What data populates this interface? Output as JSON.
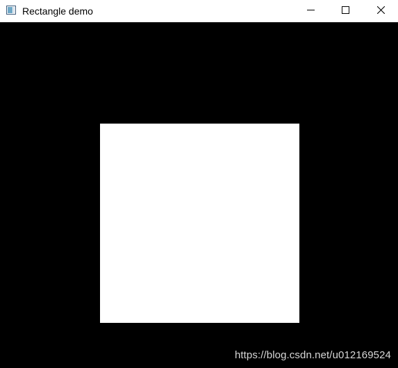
{
  "window": {
    "title": "Rectangle demo",
    "controls": {
      "minimize_icon": "minimize-icon",
      "maximize_icon": "maximize-icon",
      "close_icon": "close-icon"
    }
  },
  "canvas": {
    "background_color": "#000000",
    "shape": {
      "type": "rectangle",
      "fill_color": "#ffffff"
    }
  },
  "watermark": {
    "text": "https://blog.csdn.net/u012169524"
  }
}
